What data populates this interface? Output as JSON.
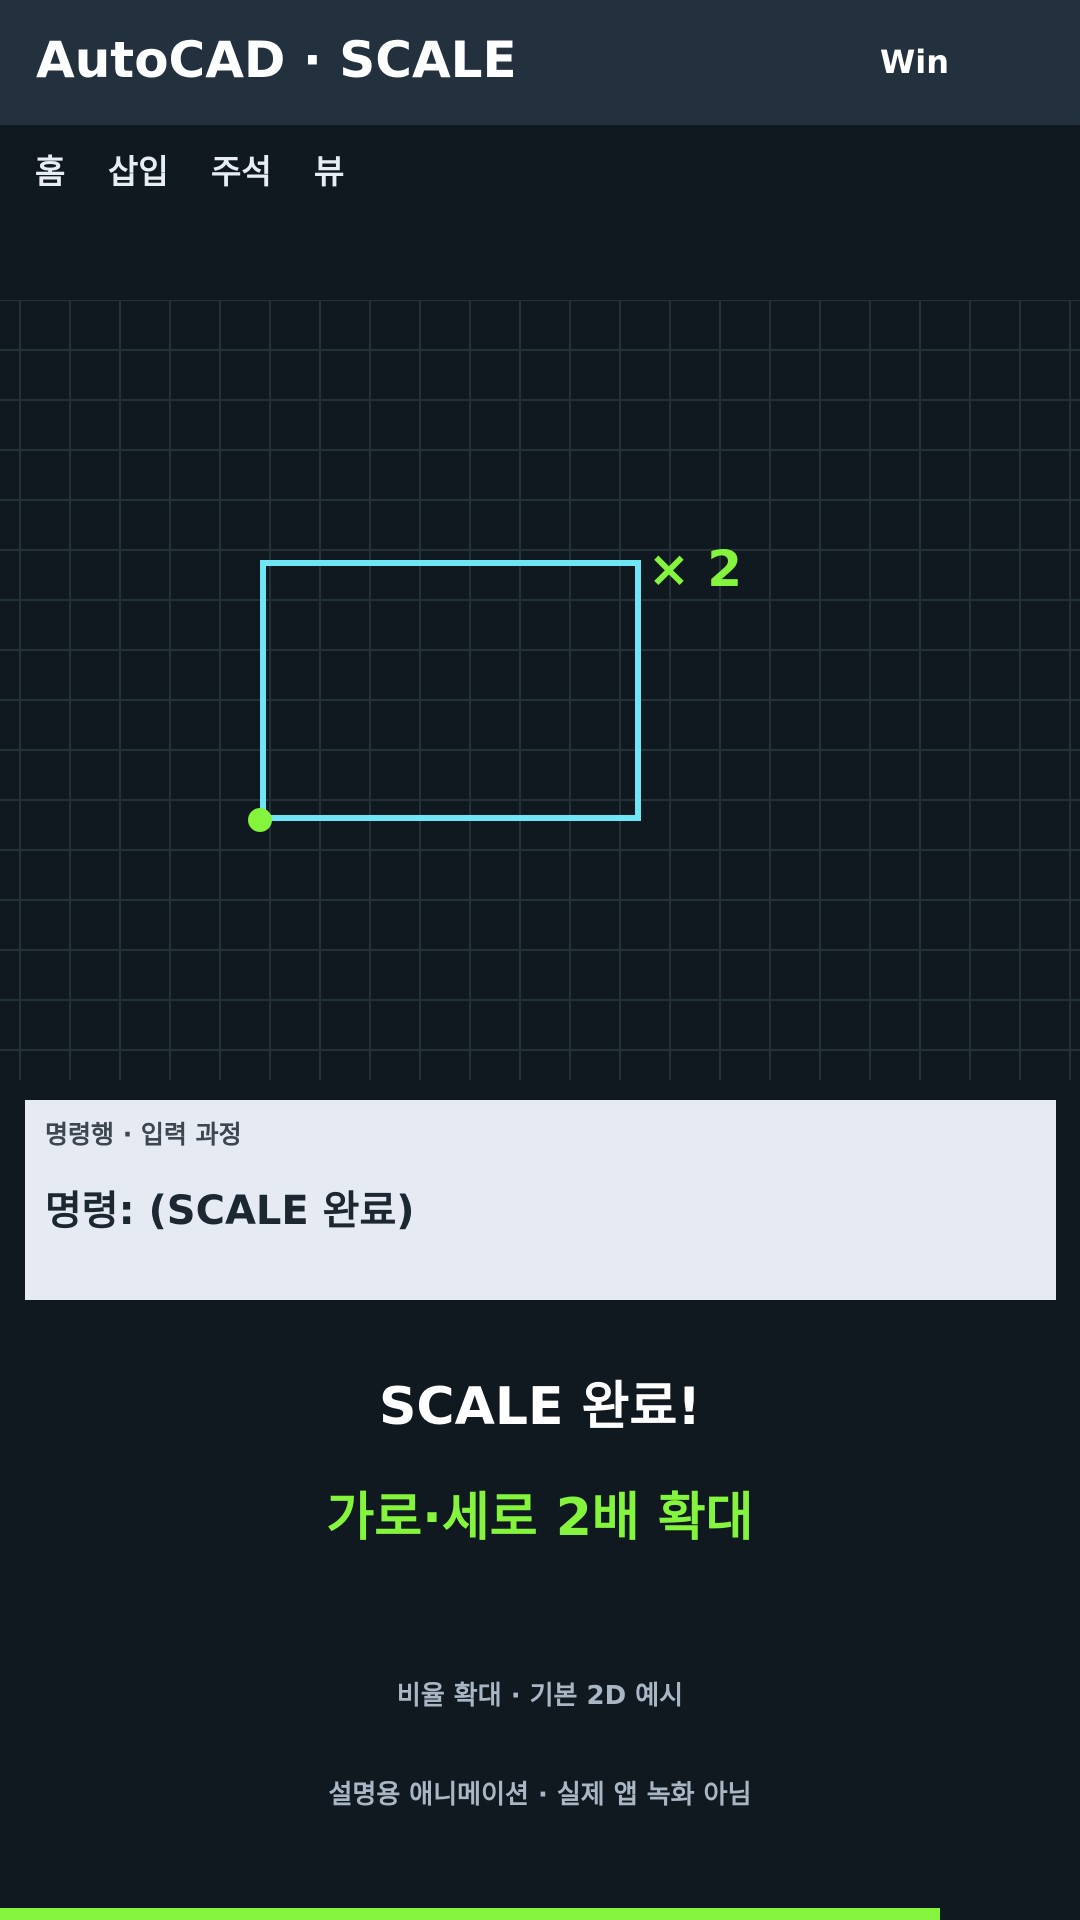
{
  "titlebar": {
    "app_title": "AutoCAD · SCALE",
    "platform": "Win"
  },
  "ribbon": {
    "tabs": [
      {
        "label": "홈"
      },
      {
        "label": "삽입"
      },
      {
        "label": "주석"
      },
      {
        "label": "뷰"
      }
    ]
  },
  "canvas": {
    "scale_label": "× 2",
    "shape_color": "#6fe6f6",
    "base_point_color": "#84f43c"
  },
  "command": {
    "caption": "명령행 · 입력 과정",
    "line": "명령: (SCALE 완료)"
  },
  "result": {
    "headline": "SCALE 완료!",
    "subline": "가로·세로 2배 확대"
  },
  "notes": {
    "note1": "비율 확대 · 기본 2D 예시",
    "note2": "설명용 애니메이션 · 실제 앱 녹화 아님"
  },
  "progress": {
    "fraction": 0.87,
    "color": "#84f43c"
  },
  "colors": {
    "background": "#111920",
    "titlebar": "#23313f",
    "accent": "#84f43c",
    "panel": "#e6ebf3"
  }
}
